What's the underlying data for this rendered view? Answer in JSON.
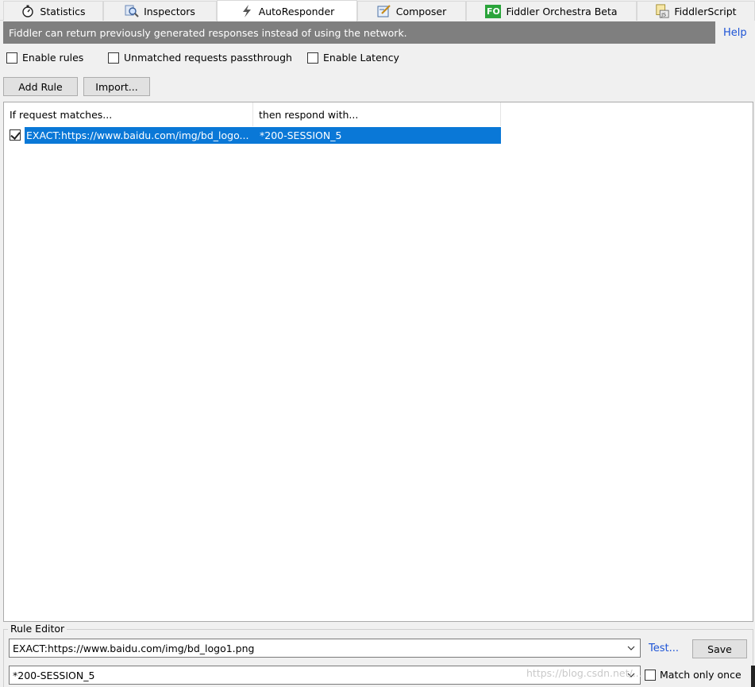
{
  "tabs": [
    {
      "label": "Statistics",
      "icon": "stopwatch-icon",
      "active": false
    },
    {
      "label": "Inspectors",
      "icon": "magnifier-icon",
      "active": false
    },
    {
      "label": "AutoResponder",
      "icon": "lightning-icon",
      "active": true
    },
    {
      "label": "Composer",
      "icon": "composer-icon",
      "active": false
    },
    {
      "label": "Fiddler Orchestra Beta",
      "icon": "fo-icon",
      "active": false,
      "icon_text": "FO"
    },
    {
      "label": "FiddlerScript",
      "icon": "script-icon",
      "active": false,
      "icon_text": "JS"
    }
  ],
  "info_bar": "Fiddler can return previously generated responses instead of using the network.",
  "help_link": "Help",
  "options": [
    {
      "label": "Enable rules",
      "checked": false
    },
    {
      "label": "Unmatched requests passthrough",
      "checked": false
    },
    {
      "label": "Enable Latency",
      "checked": false
    }
  ],
  "buttons": {
    "add_rule": "Add Rule",
    "import": "Import..."
  },
  "list": {
    "headers": [
      "If request matches...",
      "then respond with..."
    ],
    "rows": [
      {
        "checked": true,
        "match": "EXACT:https://www.baidu.com/img/bd_logo...",
        "respond": "*200-SESSION_5",
        "selected": true
      }
    ]
  },
  "rule_editor": {
    "legend": "Rule Editor",
    "match_value": "EXACT:https://www.baidu.com/img/bd_logo1.png",
    "respond_value": "*200-SESSION_5",
    "test_link": "Test...",
    "save_button": "Save",
    "match_only_once_label": "Match only once",
    "match_only_once_checked": false
  },
  "watermark": "https://blog.csdn.net/...",
  "colors": {
    "selection": "#0a78d7",
    "info_bar_bg": "#7f7f7f",
    "link": "#1c53d6"
  }
}
